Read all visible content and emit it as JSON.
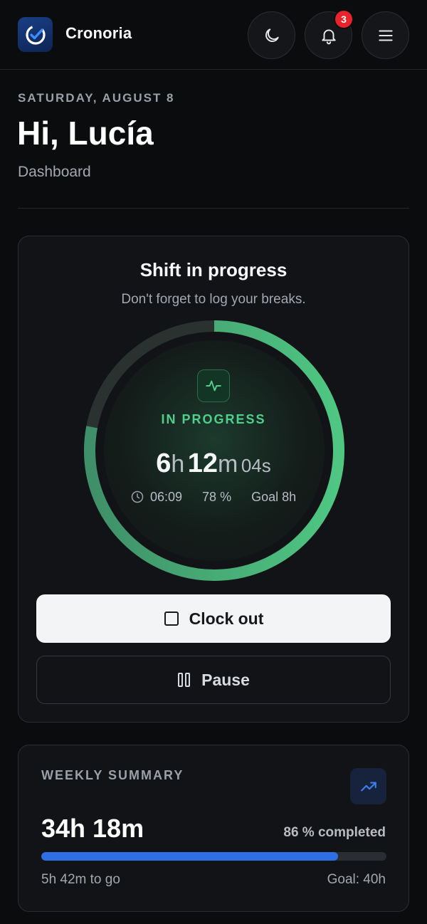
{
  "app": {
    "name": "Cronoria"
  },
  "header": {
    "notification_count": "3"
  },
  "greeting": {
    "date": "SATURDAY, AUGUST 8",
    "title": "Hi, Lucía",
    "subtitle": "Dashboard"
  },
  "shift": {
    "title": "Shift in progress",
    "subtitle": "Don't forget to log your breaks.",
    "status": "IN PROGRESS",
    "hours": "6",
    "hours_unit": "h",
    "minutes": "12",
    "minutes_unit": "m",
    "seconds": "04s",
    "start_time": "06:09",
    "percent": "78 %",
    "percent_value": 78,
    "goal": "Goal 8h",
    "clock_out_label": "Clock out",
    "pause_label": "Pause"
  },
  "weekly": {
    "title": "WEEKLY SUMMARY",
    "hours": "34h 18m",
    "percent_label": "86 % completed",
    "percent_value": 86,
    "remaining": "5h 42m to go",
    "goal": "Goal: 40h"
  },
  "colors": {
    "accent_green": "#4fcf8b",
    "accent_blue": "#2f6fe4",
    "danger": "#e5242b"
  }
}
